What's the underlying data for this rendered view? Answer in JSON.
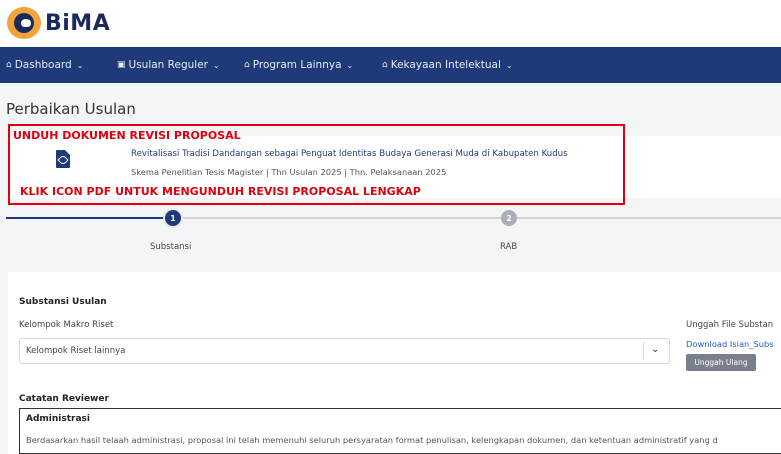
{
  "app": {
    "logo_text": "BiMA"
  },
  "nav": {
    "items": [
      {
        "icon": "home-icon",
        "label": "Dashboard"
      },
      {
        "icon": "document-icon",
        "label": "Usulan Reguler"
      },
      {
        "icon": "home-icon",
        "label": "Program Lainnya"
      },
      {
        "icon": "home-icon",
        "label": "Kekayaan Intelektual"
      }
    ]
  },
  "page": {
    "title": "Perbaikan Usulan"
  },
  "proposal": {
    "title": "Revitalisasi Tradisi Dandangan sebagai Penguat Identitas Budaya Generasi Muda di Kabupaten Kudus",
    "meta": "Skema Penelitian Tesis Magister | Thn Usulan 2025 | Thn. Pelaksanaan 2025"
  },
  "annotation": {
    "top": "UNDUH DOKUMEN REVISI PROPOSAL",
    "bottom": "KLIK ICON PDF UNTUK MENGUNDUH REVISI PROPOSAL LENGKAP",
    "color": "#e0000f"
  },
  "stepper": {
    "steps": [
      {
        "number": "1",
        "label": "Substansi",
        "active": true
      },
      {
        "number": "2",
        "label": "RAB",
        "active": false
      }
    ]
  },
  "substansi": {
    "section_title": "Substansi Usulan",
    "kelompok_label": "Kelompok Makro Riset",
    "kelompok_value": "Kelompok Riset lainnya",
    "upload_label": "Unggah File Substan",
    "download_link": "Download Isian_Subs",
    "upload_button": "Unggah Ulang"
  },
  "reviewer": {
    "title": "Catatan Reviewer",
    "subtitle": "Administrasi",
    "text": "Berdasarkan hasil telaah administrasi, proposal ini telah memenuhi seluruh persyaratan format penulisan, kelengkapan dokumen, dan ketentuan administratif yang d"
  },
  "colors": {
    "brand": "#1f3a78",
    "accent": "#f2a33a",
    "link": "#1f5fbf"
  }
}
